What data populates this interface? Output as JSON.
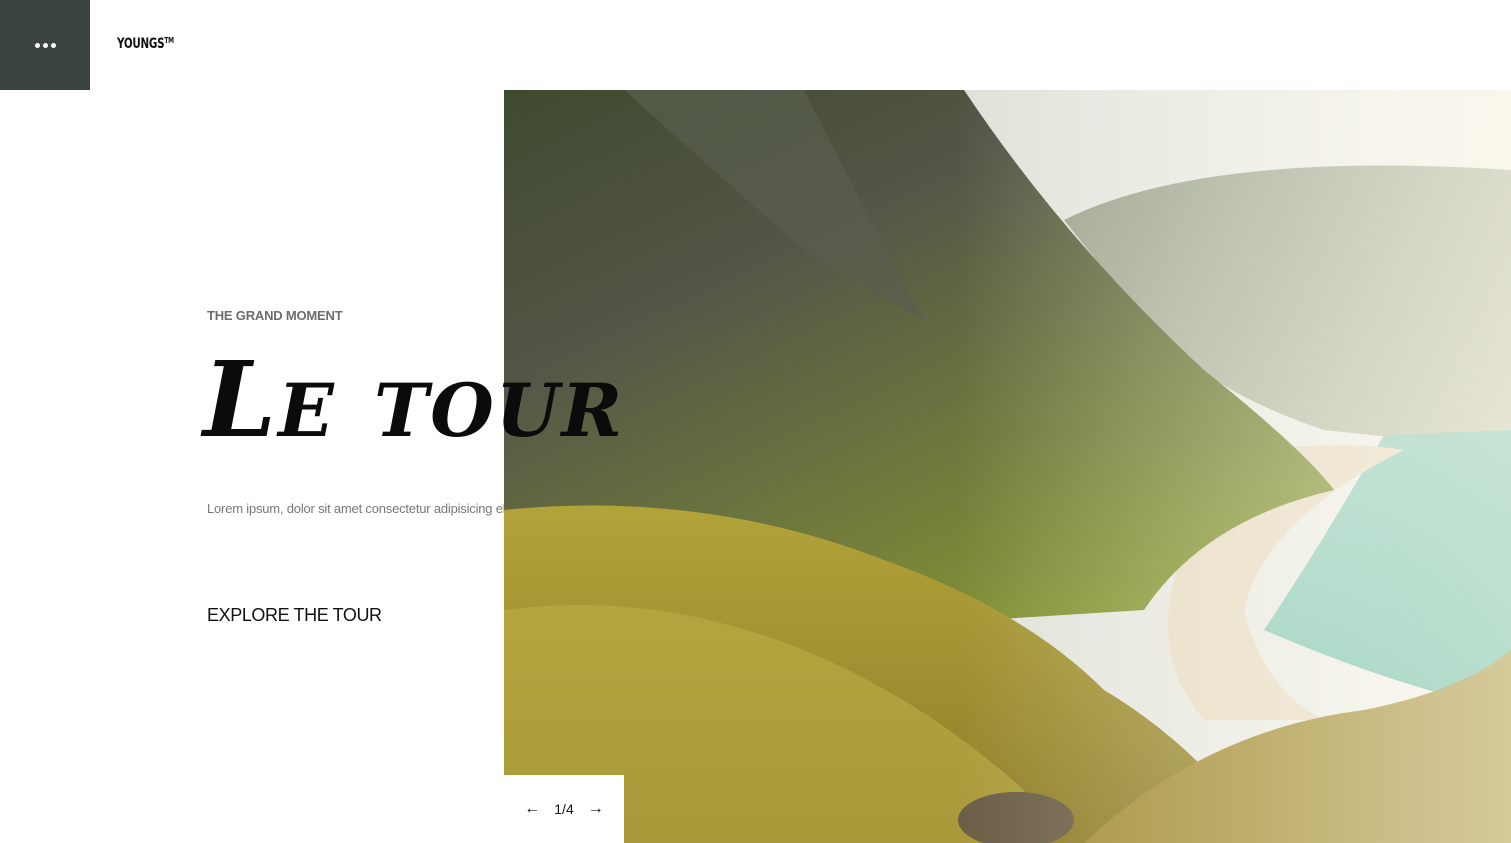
{
  "brand": {
    "name": "YOUNGS",
    "trademark": "TM"
  },
  "menu": {
    "icon": "more-horizontal-icon"
  },
  "hero": {
    "eyebrow": "THE GRAND MOMENT",
    "title": "Le tour",
    "lead": "Lorem ipsum, dolor sit amet consectetur adipisicing elit",
    "cta_label": "EXPLORE THE TOUR"
  },
  "slider": {
    "prev_icon": "arrow-left-icon",
    "next_icon": "arrow-right-icon",
    "prev_glyph": "←",
    "next_glyph": "→",
    "current": "1",
    "separator": "/",
    "total": "4"
  },
  "colors": {
    "menu_bg": "#3a4242",
    "text": "#111111",
    "muted": "#6c6c6c"
  }
}
